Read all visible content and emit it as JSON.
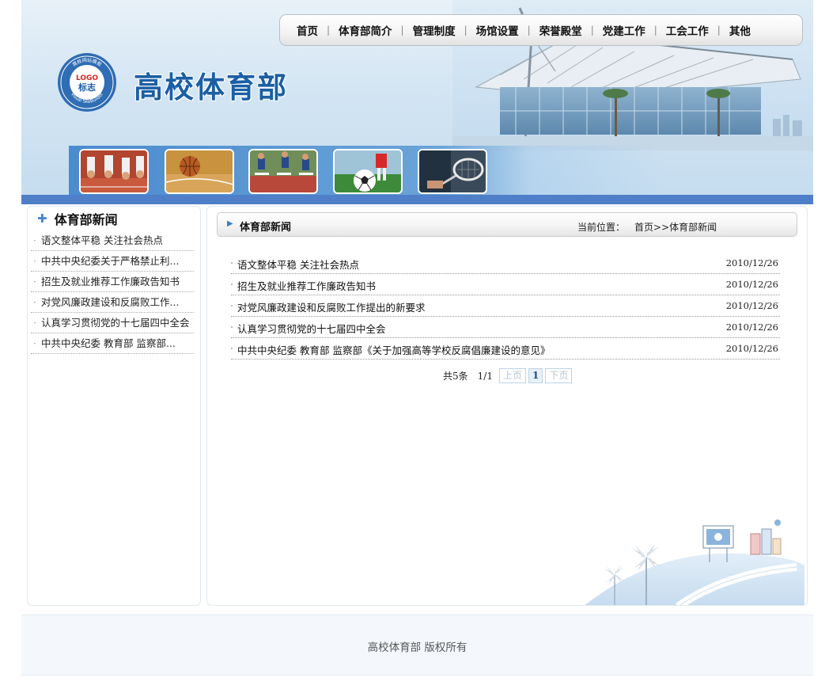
{
  "site": {
    "title": "高校体育部",
    "logo_label": "LOGO",
    "logo_sub": "标志",
    "logo_ring_top": "高校网站模板",
    "logo_ring_bottom": "Visual SiteBuilder"
  },
  "nav": {
    "items": [
      {
        "label": "首页"
      },
      {
        "label": "体育部简介"
      },
      {
        "label": "管理制度"
      },
      {
        "label": "场馆设置"
      },
      {
        "label": "荣誉殿堂"
      },
      {
        "label": "党建工作"
      },
      {
        "label": "工会工作"
      },
      {
        "label": "其他"
      }
    ],
    "separator": "|"
  },
  "banner": {
    "photos": [
      "running-photo",
      "basketball-photo",
      "hurdles-photo",
      "soccer-photo",
      "tennis-photo"
    ]
  },
  "sidebar": {
    "title": "体育部新闻",
    "items": [
      {
        "label": "语文整体平稳 关注社会热点"
      },
      {
        "label": "中共中央纪委关于严格禁止利..."
      },
      {
        "label": "招生及就业推荐工作廉政告知书"
      },
      {
        "label": "对党风廉政建设和反腐败工作..."
      },
      {
        "label": "认真学习贯彻党的十七届四中全会"
      },
      {
        "label": "中共中央纪委 教育部 监察部..."
      }
    ]
  },
  "main": {
    "title": "体育部新闻",
    "breadcrumb_label": "当前位置：",
    "breadcrumb_path": "首页>>体育部新闻",
    "news": [
      {
        "title": "语文整体平稳 关注社会热点",
        "date": "2010/12/26"
      },
      {
        "title": "招生及就业推荐工作廉政告知书",
        "date": "2010/12/26"
      },
      {
        "title": "对党风廉政建设和反腐败工作提出的新要求",
        "date": "2010/12/26"
      },
      {
        "title": "认真学习贯彻党的十七届四中全会",
        "date": "2010/12/26"
      },
      {
        "title": "中共中央纪委 教育部 监察部《关于加强高等学校反腐倡廉建设的意见》",
        "date": "2010/12/26"
      }
    ],
    "pager": {
      "count": "共5条",
      "page": "1/1",
      "prev": "上页",
      "current": "1",
      "next": "下页"
    }
  },
  "footer": {
    "text": "高校体育部  版权所有"
  },
  "colors": {
    "brand_blue": "#1b5fa4",
    "bar_blue": "#4f7fc9",
    "accent": "#4a86c9"
  }
}
